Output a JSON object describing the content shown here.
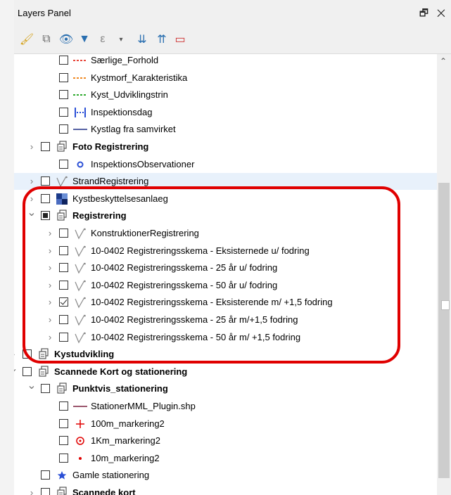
{
  "panel": {
    "title": "Layers Panel",
    "controls": "🗗 ✕"
  },
  "toolbar": {
    "buttons": [
      {
        "name": "style-manager-icon",
        "glyph": "🖌"
      },
      {
        "name": "add-group-icon",
        "glyph": "⧉"
      },
      {
        "name": "visibility-icon",
        "glyph": "👁"
      },
      {
        "name": "filter-icon",
        "glyph": "▼"
      },
      {
        "name": "expression-filter-icon",
        "glyph": "ε"
      },
      {
        "name": "expand-all-icon",
        "glyph": "⇊"
      },
      {
        "name": "collapse-all-icon",
        "glyph": "⇈"
      },
      {
        "name": "remove-layer-icon",
        "glyph": "▭"
      }
    ]
  },
  "colors": {
    "highlight": "#e00000",
    "red_dash": "#e8473a",
    "orange_dash": "#f08a24",
    "green_dash": "#2eaa2e",
    "blue": "#2a4fd6",
    "navy": "#1f2f86",
    "maroon": "#7a1f3d",
    "red": "#e00000"
  },
  "tree": {
    "rows": [
      {
        "label": "Særlige_Forhold",
        "bold": false,
        "check": "none",
        "arrow": "",
        "symbol": "dash-red",
        "depth": 2
      },
      {
        "label": "Kystmorf_Karakteristika",
        "bold": false,
        "check": "none",
        "arrow": "",
        "symbol": "dash-orange",
        "depth": 2
      },
      {
        "label": "Kyst_Udviklingstrin",
        "bold": false,
        "check": "none",
        "arrow": "",
        "symbol": "dash-green",
        "depth": 2
      },
      {
        "label": "Inspektionsdag",
        "bold": false,
        "check": "none",
        "arrow": "",
        "symbol": "bracket-blue",
        "depth": 2
      },
      {
        "label": "Kystlag fra samvirket",
        "bold": false,
        "check": "none",
        "arrow": "",
        "symbol": "line-navy",
        "depth": 2
      },
      {
        "label": "Foto Registrering",
        "bold": true,
        "check": "none",
        "arrow": ">",
        "symbol": "group",
        "depth": 1
      },
      {
        "label": "InspektionsObservationer",
        "bold": false,
        "check": "none",
        "arrow": "",
        "symbol": "dot-blue",
        "depth": 2
      },
      {
        "label": "StrandRegistrering",
        "bold": false,
        "check": "none",
        "arrow": ">",
        "symbol": "vector",
        "depth": 1,
        "selected": true
      },
      {
        "label": "Kystbeskyttelsesanlaeg",
        "bold": false,
        "check": "none",
        "arrow": ">",
        "symbol": "raster",
        "depth": 1
      },
      {
        "label": "Registrering",
        "bold": true,
        "check": "partial",
        "arrow": "v",
        "symbol": "group",
        "depth": 1
      },
      {
        "label": "KonstruktionerRegistrering",
        "bold": false,
        "check": "none",
        "arrow": ">",
        "symbol": "vector",
        "depth": 2
      },
      {
        "label": "10-0402 Registreringsskema - Eksisternede u/ fodring",
        "bold": false,
        "check": "none",
        "arrow": ">",
        "symbol": "vector",
        "depth": 2
      },
      {
        "label": "10-0402 Registreringsskema - 25 år u/ fodring",
        "bold": false,
        "check": "none",
        "arrow": ">",
        "symbol": "vector",
        "depth": 2
      },
      {
        "label": "10-0402 Registreringsskema - 50 år u/ fodring",
        "bold": false,
        "check": "none",
        "arrow": ">",
        "symbol": "vector",
        "depth": 2
      },
      {
        "label": "10-0402 Registreringsskema - Eksisterende m/ +1,5 fodring",
        "bold": false,
        "check": "checked",
        "arrow": ">",
        "symbol": "vector",
        "depth": 2
      },
      {
        "label": "10-0402 Registreringsskema - 25 år m/+1,5  fodring",
        "bold": false,
        "check": "none",
        "arrow": ">",
        "symbol": "vector",
        "depth": 2
      },
      {
        "label": "10-0402 Registreringsskema - 50 år m/ +1,5 fodring",
        "bold": false,
        "check": "none",
        "arrow": ">",
        "symbol": "vector",
        "depth": 2
      },
      {
        "label": "Kystudvikling",
        "bold": true,
        "check": "none",
        "arrow": ">",
        "symbol": "group",
        "depth": 0
      },
      {
        "label": "Scannede Kort og stationering",
        "bold": true,
        "check": "none",
        "arrow": "v",
        "symbol": "group",
        "depth": 0
      },
      {
        "label": "Punktvis_stationering",
        "bold": true,
        "check": "none",
        "arrow": "v",
        "symbol": "group",
        "depth": 1
      },
      {
        "label": "StationerMML_Plugin.shp",
        "bold": false,
        "check": "none",
        "arrow": "",
        "symbol": "line-maroon",
        "depth": 2
      },
      {
        "label": "100m_markering2",
        "bold": false,
        "check": "none",
        "arrow": "",
        "symbol": "plus-red",
        "depth": 2
      },
      {
        "label": "1Km_markering2",
        "bold": false,
        "check": "none",
        "arrow": "",
        "symbol": "target-red",
        "depth": 2
      },
      {
        "label": "10m_markering2",
        "bold": false,
        "check": "none",
        "arrow": "",
        "symbol": "dot-red",
        "depth": 2
      },
      {
        "label": "Gamle stationering",
        "bold": false,
        "check": "none",
        "arrow": "",
        "symbol": "star-blue",
        "depth": 1
      },
      {
        "label": "Scannede kort",
        "bold": true,
        "check": "none",
        "arrow": ">",
        "symbol": "group",
        "depth": 1
      }
    ]
  }
}
